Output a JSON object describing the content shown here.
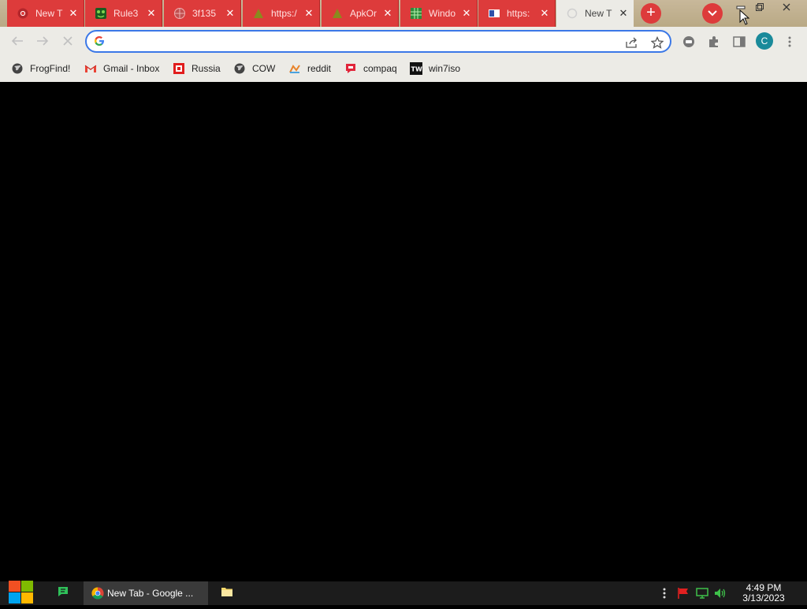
{
  "tabs": [
    {
      "title": "New T",
      "favicon": "chrome-icon"
    },
    {
      "title": "Rule3",
      "favicon": "frog-icon"
    },
    {
      "title": "3f135",
      "favicon": "globe-icon"
    },
    {
      "title": "https:/",
      "favicon": "triangle-icon"
    },
    {
      "title": "ApkOr",
      "favicon": "triangle-icon"
    },
    {
      "title": "Windo",
      "favicon": "grid-icon"
    },
    {
      "title": "https:",
      "favicon": "blue-square-icon"
    },
    {
      "title": "New T",
      "favicon": "loading-icon",
      "active": true
    }
  ],
  "tab_close_glyph": "✕",
  "new_tab_glyph": "+",
  "omnibox": {
    "value": "",
    "placeholder": ""
  },
  "profile_initial": "C",
  "bookmarks": [
    {
      "label": "FrogFind!",
      "icon": "globe-icon"
    },
    {
      "label": "Gmail - Inbox",
      "icon": "gmail-icon"
    },
    {
      "label": "Russia",
      "icon": "red-app-icon"
    },
    {
      "label": "COW",
      "icon": "globe-icon"
    },
    {
      "label": "reddit",
      "icon": "reddit-icon"
    },
    {
      "label": "compaq",
      "icon": "compaq-icon"
    },
    {
      "label": "win7iso",
      "icon": "tw-icon"
    }
  ],
  "taskbar": {
    "chrome_window": "New Tab - Google ...",
    "time": "4:49 PM",
    "date": "3/13/2023"
  },
  "colors": {
    "tab_red": "#dd3b3b",
    "toolbar": "#ecebe6",
    "omnibox_border": "#3b78e7",
    "avatar": "#1a8a9a",
    "taskbar": "#1c1c1c"
  }
}
